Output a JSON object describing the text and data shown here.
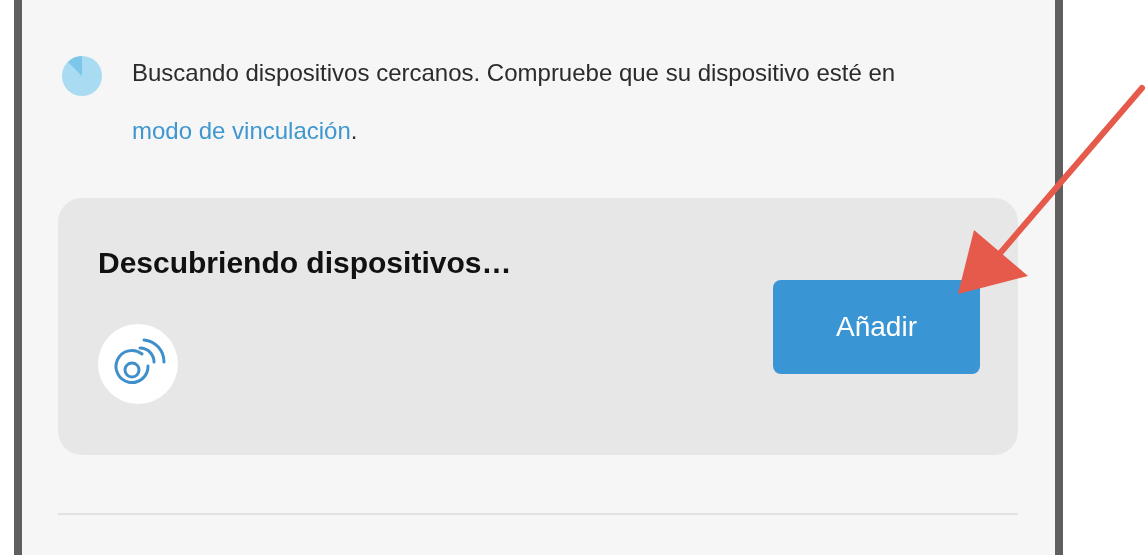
{
  "notice": {
    "text_before": "Buscando dispositivos cercanos. Compruebe que su dispositivo esté en ",
    "link": "modo de vinculación",
    "text_after": "."
  },
  "discovery_card": {
    "title": "Descubriendo dispositivos…",
    "button": "Añadir"
  },
  "annotation": {
    "kind": "arrow"
  }
}
